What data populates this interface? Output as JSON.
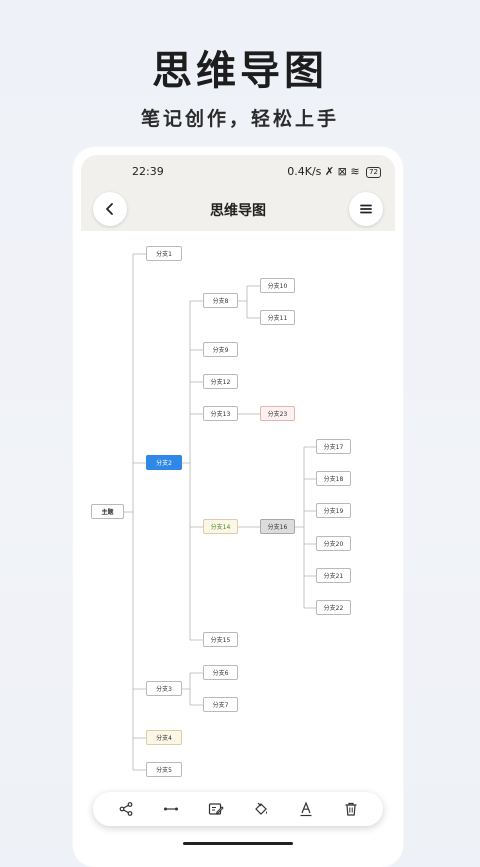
{
  "promo": {
    "title": "思维导图",
    "subtitle": "笔记创作，轻松上手"
  },
  "status_bar": {
    "time": "22:39",
    "net_speed": "0.4K/s",
    "battery": "72"
  },
  "header": {
    "title": "思维导图",
    "back_icon": "chevron-left-icon",
    "menu_icon": "hamburger-menu-icon"
  },
  "mindmap": {
    "root": "主题",
    "nodes": {
      "b1": "分支1",
      "b2": "分支2",
      "b3": "分支3",
      "b4": "分支4",
      "b5": "分支5",
      "b6": "分支6",
      "b7": "分支7",
      "b8": "分支8",
      "b9": "分支9",
      "b10": "分支10",
      "b11": "分支11",
      "b12": "分支12",
      "b13": "分支13",
      "b14": "分支14",
      "b15": "分支15",
      "b16": "分支16",
      "b17": "分支17",
      "b18": "分支18",
      "b19": "分支19",
      "b20": "分支20",
      "b21": "分支21",
      "b22": "分支22",
      "b23": "分支23"
    },
    "selected": "分支2",
    "colors": {
      "selected": "#2f88e6",
      "cream": "#fbf6e6",
      "pink": "#fdf1f1",
      "grey": "#dcdcdc",
      "connector": "#b5b5b5"
    }
  },
  "toolbar": {
    "tools": [
      "share-node-icon",
      "connect-line-icon",
      "edit-note-icon",
      "fill-color-icon",
      "text-style-icon",
      "trash-icon"
    ]
  }
}
